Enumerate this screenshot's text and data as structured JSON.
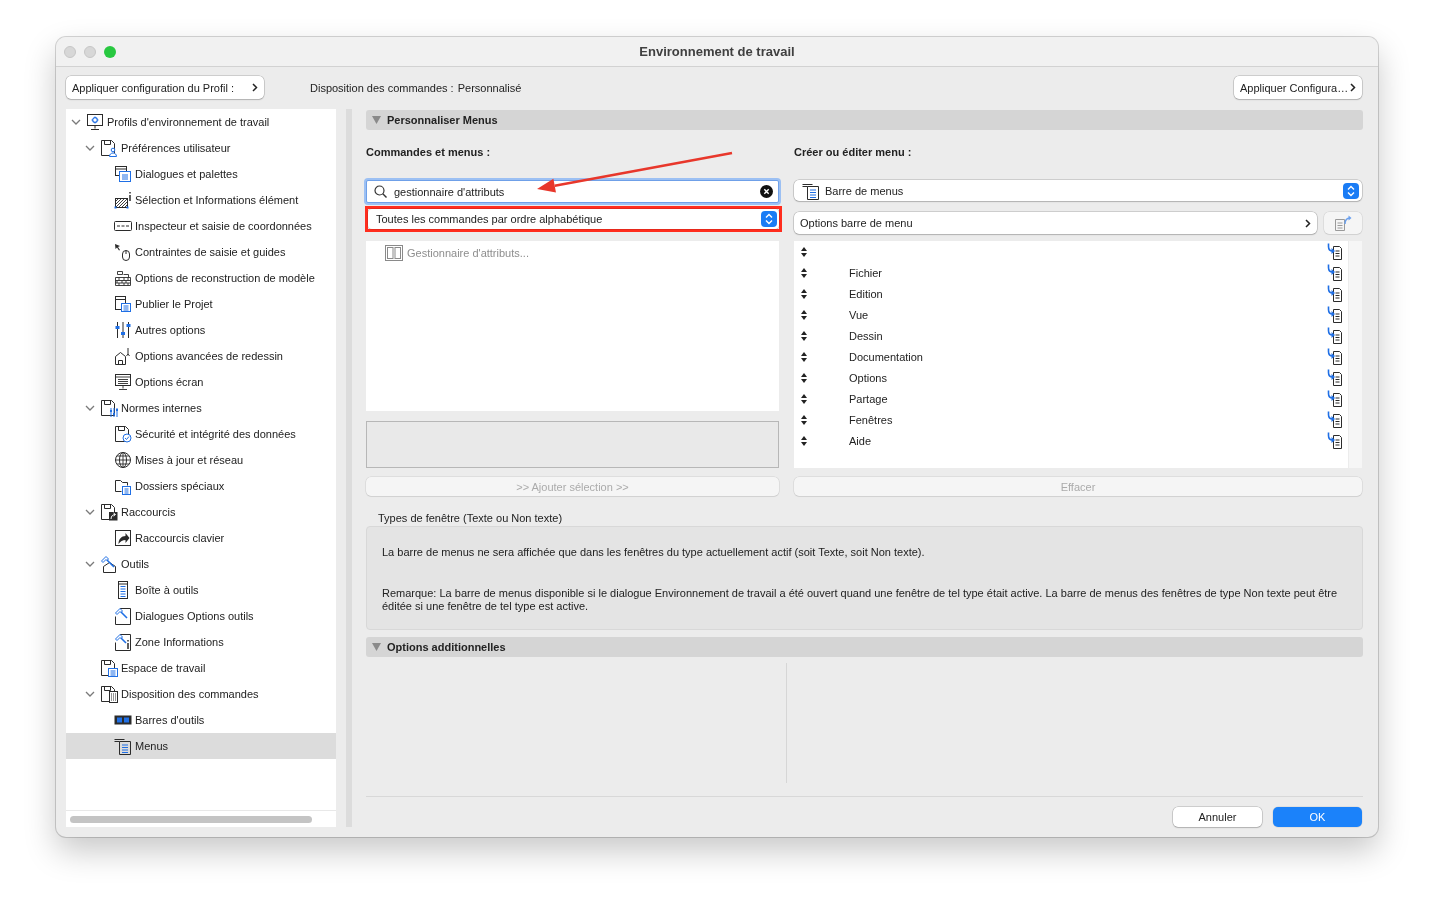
{
  "window": {
    "title": "Environnement de travail",
    "controls": [
      {
        "kind": "close",
        "enabled": false
      },
      {
        "kind": "minimize",
        "enabled": false
      },
      {
        "kind": "zoom",
        "enabled": true
      }
    ]
  },
  "toolbar": {
    "profile_button": "Appliquer configuration du Profil :",
    "layout_label": "Disposition des commandes :",
    "layout_value": "Personnalisé",
    "apply_button": "Appliquer Configura…"
  },
  "tree": {
    "items": [
      {
        "label": "Profils d'environnement de travail",
        "expanded": true,
        "selected": false,
        "children": [
          {
            "label": "Préférences utilisateur",
            "expanded": true,
            "selected": false,
            "children": [
              {
                "label": "Dialogues et palettes",
                "selected": false
              },
              {
                "label": "Sélection et Informations élément",
                "selected": false
              },
              {
                "label": "Inspecteur et saisie de coordonnées",
                "selected": false
              },
              {
                "label": "Contraintes de saisie et guides",
                "selected": false
              },
              {
                "label": "Options de reconstruction de modèle",
                "selected": false
              },
              {
                "label": "Publier le Projet",
                "selected": false
              },
              {
                "label": "Autres options",
                "selected": false
              },
              {
                "label": "Options avancées de redessin",
                "selected": false
              },
              {
                "label": "Options écran",
                "selected": false
              }
            ]
          },
          {
            "label": "Normes internes",
            "expanded": true,
            "selected": false,
            "children": [
              {
                "label": "Sécurité et intégrité des données",
                "selected": false
              },
              {
                "label": "Mises à jour et réseau",
                "selected": false
              },
              {
                "label": "Dossiers spéciaux",
                "selected": false
              }
            ]
          },
          {
            "label": "Raccourcis",
            "expanded": true,
            "selected": false,
            "children": [
              {
                "label": "Raccourcis clavier",
                "selected": false
              }
            ]
          },
          {
            "label": "Outils",
            "expanded": true,
            "selected": false,
            "children": [
              {
                "label": "Boîte à outils",
                "selected": false
              },
              {
                "label": "Dialogues Options outils",
                "selected": false
              },
              {
                "label": "Zone Informations",
                "selected": false
              }
            ]
          },
          {
            "label": "Espace de travail",
            "selected": false
          },
          {
            "label": "Disposition des commandes",
            "expanded": true,
            "selected": false,
            "children": [
              {
                "label": "Barres d'outils",
                "selected": false
              },
              {
                "label": "Menus",
                "selected": true
              }
            ]
          }
        ]
      }
    ]
  },
  "customize_section": {
    "title": "Personnaliser Menus",
    "expanded": true,
    "commands": {
      "label": "Commandes et menus :",
      "search": {
        "value": "gestionnaire d'attributs",
        "focused": true,
        "annotated": true
      },
      "filter": {
        "value": "Toutes les commandes par ordre alphabétique",
        "highlighted": true
      },
      "items": [
        {
          "label": "Gestionnaire d'attributs...",
          "disabled": true
        }
      ],
      "add_button": {
        "label": ">> Ajouter sélection >>",
        "disabled": true
      }
    },
    "menu_editor": {
      "label": "Créer ou éditer menu :",
      "menu_select": "Barre de menus",
      "options_button": "Options barre de menu",
      "export_button": {
        "disabled": true
      },
      "items": [
        {
          "kind": "blank"
        },
        {
          "kind": "menu",
          "name": "Fichier"
        },
        {
          "kind": "menu",
          "name": "Edition"
        },
        {
          "kind": "menu",
          "name": "Vue"
        },
        {
          "kind": "menu",
          "name": "Dessin"
        },
        {
          "kind": "menu",
          "name": "Documentation"
        },
        {
          "kind": "menu",
          "name": "Options"
        },
        {
          "kind": "menu",
          "name": "Partage"
        },
        {
          "kind": "menu",
          "name": "Fenêtres"
        },
        {
          "kind": "menu",
          "name": "Aide"
        }
      ],
      "clear_button": {
        "label": "Effacer",
        "disabled": true
      }
    },
    "window_types": {
      "title": "Types de fenêtre (Texte ou Non texte)",
      "paragraphs": [
        "La barre de menus ne sera affichée que dans les fenêtres du type actuellement actif (soit Texte, soit Non texte).",
        "Remarque: La barre de menus disponible si le dialogue Environnement de travail a été ouvert quand une fenêtre de tel type était active. La barre de menus des fenêtres de type Non texte peut être éditée si une fenêtre de tel type est active."
      ]
    }
  },
  "additional_section": {
    "title": "Options additionnelles",
    "expanded": true
  },
  "footer": {
    "buttons": [
      {
        "label": "Annuler",
        "default": false
      },
      {
        "label": "OK",
        "default": true
      }
    ]
  }
}
